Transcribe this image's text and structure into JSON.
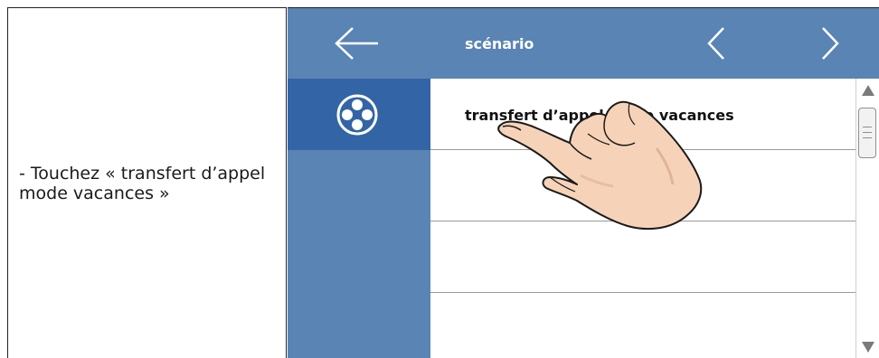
{
  "instruction": {
    "text": "- Touchez « transfert d’appel mode vacances »"
  },
  "header": {
    "title": "scénario",
    "back_icon": "arrow-left-icon",
    "prev_icon": "chevron-left-icon",
    "next_icon": "chevron-right-icon"
  },
  "sidebar": {
    "active_icon": "scenario-icon"
  },
  "list": {
    "items": [
      {
        "label": "transfert d’appel mode vacances"
      },
      {
        "label": ""
      },
      {
        "label": ""
      },
      {
        "label": ""
      }
    ]
  },
  "colors": {
    "screen_bg": "#5a84b4",
    "sidebar_active": "#3364a5",
    "list_bg": "#ffffff",
    "divider": "#9a9a9a"
  }
}
